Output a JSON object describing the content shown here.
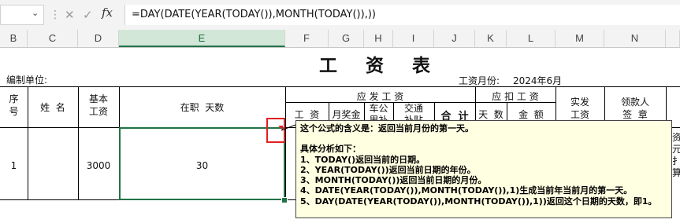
{
  "formula_bar": {
    "cancel_icon": "✕",
    "confirm_icon": "✓",
    "fx_label": "fx",
    "formula": "=DAY(DATE(YEAR(TODAY()),MONTH(TODAY()),))"
  },
  "columns": [
    "B",
    "C",
    "D",
    "E",
    "F",
    "G",
    "H",
    "I",
    "J",
    "K",
    "L",
    "M",
    "N"
  ],
  "sheet": {
    "title": "工 资 表",
    "org_label": "编制单位:",
    "month_label": "工资月份:",
    "month_value": "2024年6月",
    "headers": {
      "seq": "序\n号",
      "name": "姓  名",
      "base": "基本\n工资",
      "days": "在职  天数",
      "payable": "应 发 工 资",
      "wage": "工  资",
      "bonus": "月奖金",
      "car": "车公\n里补",
      "traffic": "交通\n补贴",
      "subtotal": "合  计",
      "deduct": "应 扣 工 资",
      "ded_days": "天  数",
      "ded_amount": "金  额",
      "net": "实发\n工资",
      "signer": "领款人\n签  章",
      "right_partial": [
        "资",
        "元",
        "扌",
        "算"
      ]
    },
    "row": {
      "seq": "1",
      "name": "",
      "base": "3000",
      "days": "30"
    }
  },
  "comment": {
    "lines": [
      "这个公式的含义是：返回当前月份的第一天。",
      "",
      "具体分析如下：",
      "1、TODAY()返回当前的日期。",
      "2、YEAR(TODAY())返回当前日期的年份。",
      "3、MONTH(TODAY())返回当前日期的月份。",
      "4、DATE(YEAR(TODAY()),MONTH(TODAY()),1)生成当前年当前月的第一天。",
      "5、DAY(DATE(YEAR(TODAY()),MONTH(TODAY()),1))返回这个日期的天数，即1。"
    ]
  },
  "colors": {
    "accent": "#217346",
    "comment_bg": "#ffffe1",
    "highlight": "#e02020"
  }
}
